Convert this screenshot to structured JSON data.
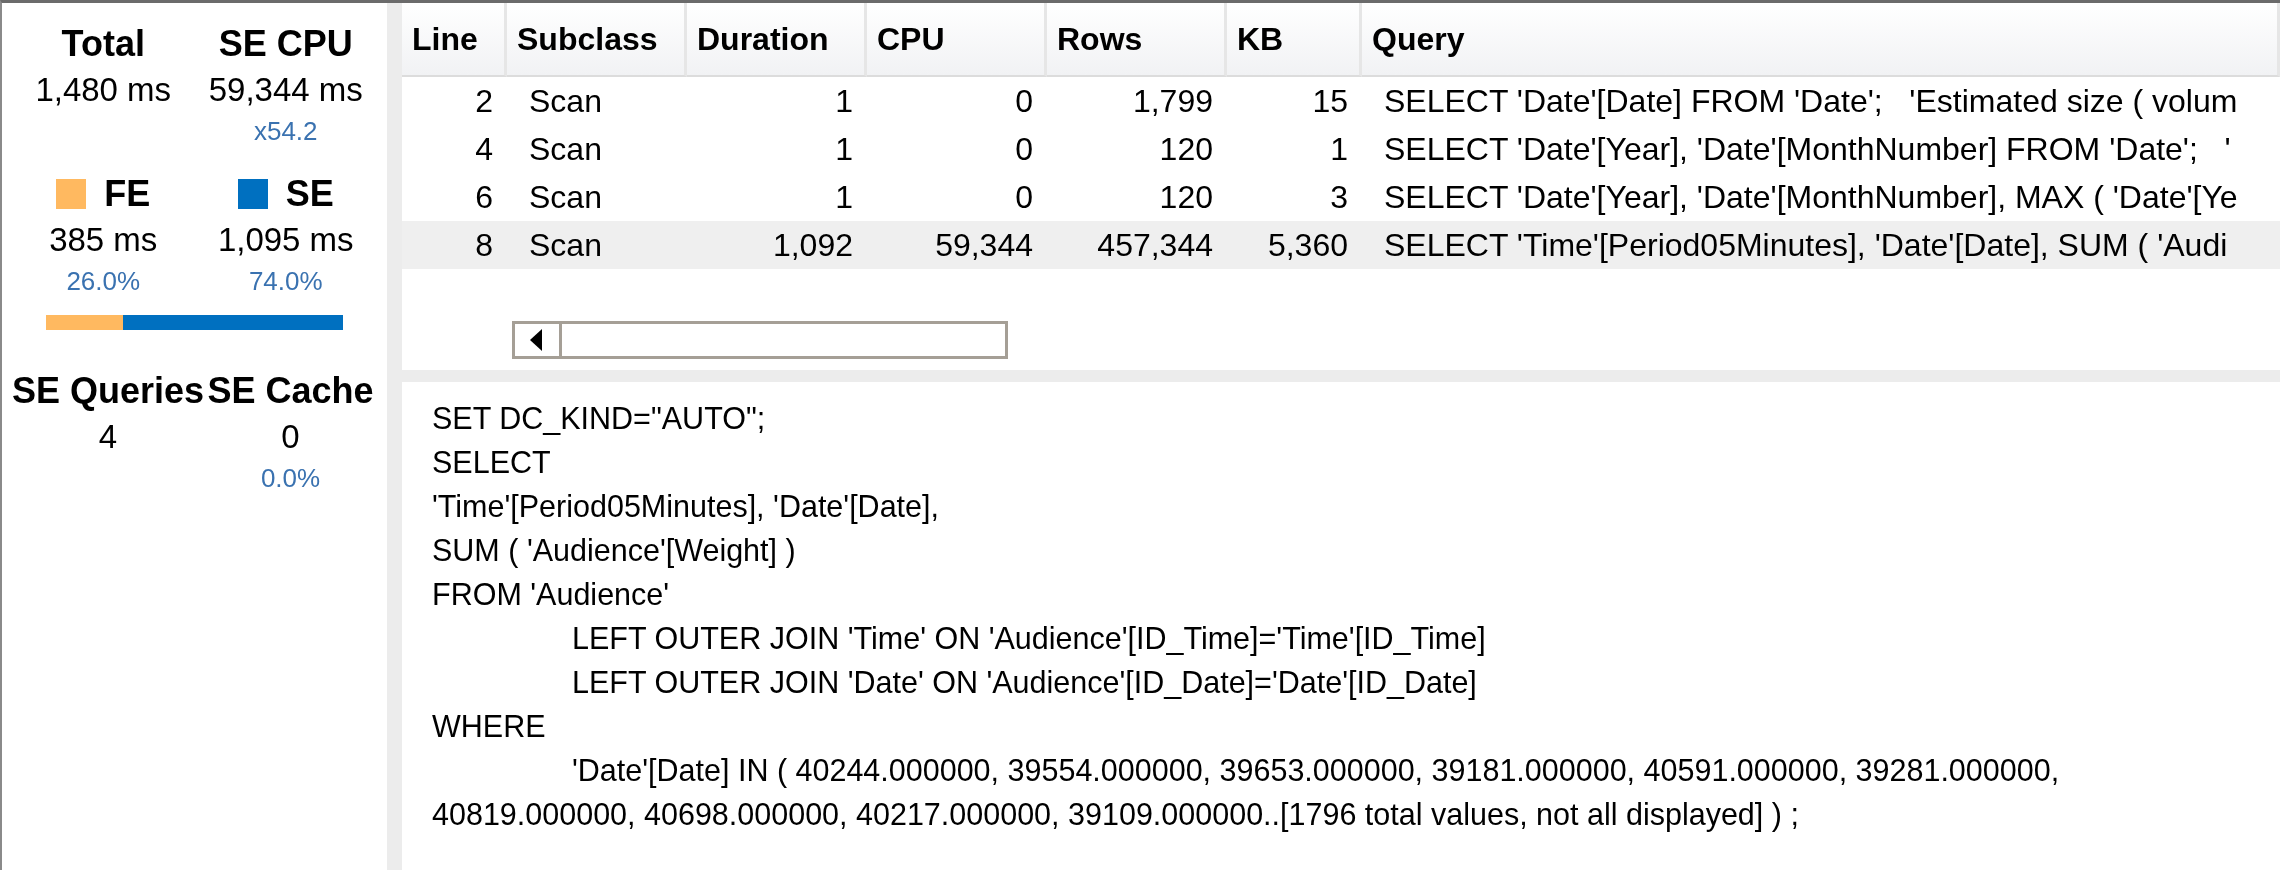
{
  "summary": {
    "metrics": [
      {
        "label": "Total",
        "value": "1,480 ms"
      },
      {
        "label": "SE CPU",
        "value": "59,344 ms",
        "note": "x54.2"
      }
    ],
    "split": [
      {
        "label": "FE",
        "color": "#ffb960",
        "value": "385 ms",
        "note": "26.0%"
      },
      {
        "label": "SE",
        "color": "#0070c0",
        "value": "1,095 ms",
        "note": "74.0%"
      }
    ],
    "bar": {
      "level": 0.26
    },
    "counts": [
      {
        "label": "SE Queries",
        "value": "4"
      },
      {
        "label": "SE Cache",
        "value": "0",
        "note": "0.0%"
      }
    ]
  },
  "table": {
    "columns": [
      "Line",
      "Subclass",
      "Duration",
      "CPU",
      "Rows",
      "KB",
      "Query"
    ],
    "rows": [
      {
        "selected": false,
        "cells": [
          "2",
          "Scan",
          "1",
          "0",
          "1,799",
          "15",
          "SELECT 'Date'[Date] FROM 'Date';   'Estimated size ( volum"
        ]
      },
      {
        "selected": false,
        "cells": [
          "4",
          "Scan",
          "1",
          "0",
          "120",
          "1",
          "SELECT 'Date'[Year], 'Date'[MonthNumber] FROM 'Date';   '"
        ]
      },
      {
        "selected": false,
        "cells": [
          "6",
          "Scan",
          "1",
          "0",
          "120",
          "3",
          "SELECT 'Date'[Year], 'Date'[MonthNumber], MAX ( 'Date'[Ye"
        ]
      },
      {
        "selected": true,
        "cells": [
          "8",
          "Scan",
          "1,092",
          "59,344",
          "457,344",
          "5,360",
          "SELECT 'Time'[Period05Minutes], 'Date'[Date], SUM ( 'Audi"
        ]
      }
    ]
  },
  "query_text": [
    {
      "text": "SET DC_KIND=\"AUTO\";",
      "indented": false
    },
    {
      "text": "SELECT",
      "indented": false
    },
    {
      "text": "'Time'[Period05Minutes], 'Date'[Date],",
      "indented": false
    },
    {
      "text": "SUM ( 'Audience'[Weight] )",
      "indented": false
    },
    {
      "text": "FROM 'Audience'",
      "indented": false
    },
    {
      "text": "LEFT OUTER JOIN 'Time' ON 'Audience'[ID_Time]='Time'[ID_Time]",
      "indented": true
    },
    {
      "text": "LEFT OUTER JOIN 'Date' ON 'Audience'[ID_Date]='Date'[ID_Date]",
      "indented": true
    },
    {
      "text": "WHERE",
      "indented": false
    },
    {
      "text": "'Date'[Date] IN ( 40244.000000, 39554.000000, 39653.000000, 39181.000000, 40591.000000, 39281.000000, 40819.000000, 40698.000000, 40217.000000, 39109.000000..[1796 total values, not all displayed] ) ;",
      "indented": true
    }
  ]
}
